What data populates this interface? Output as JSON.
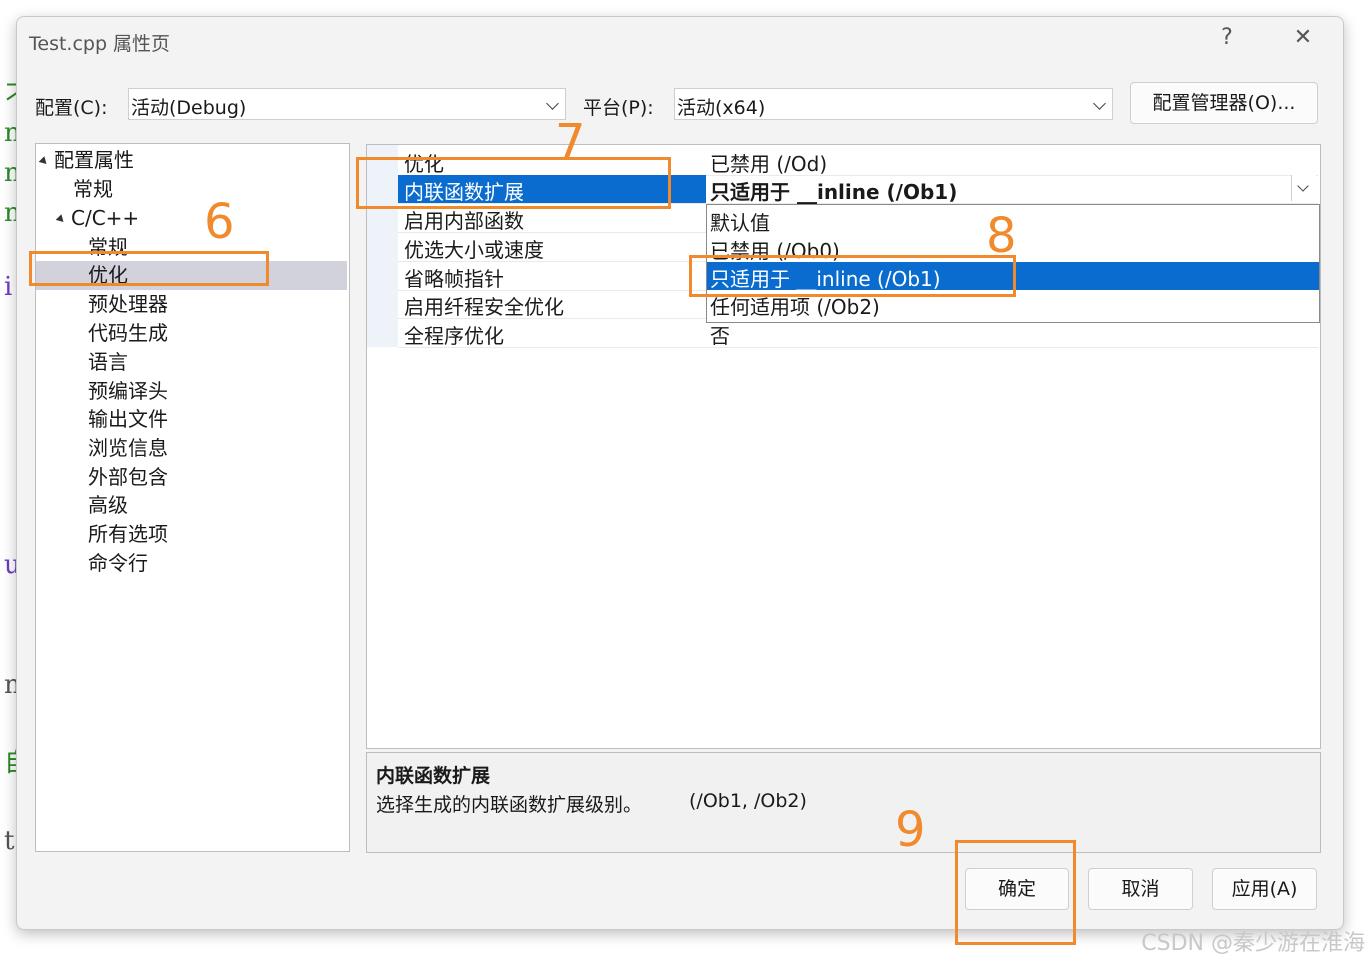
{
  "background_fragments": [
    "刁",
    "n",
    "n",
    "n",
    "i",
    "u",
    "n",
    "自",
    "t"
  ],
  "dialog": {
    "title": "Test.cpp 属性页",
    "help": "?",
    "close": "✕"
  },
  "toolbar": {
    "config_label": "配置(C):",
    "config_value": "活动(Debug)",
    "platform_label": "平台(P):",
    "platform_value": "活动(x64)",
    "config_manager": "配置管理器(O)..."
  },
  "tree": {
    "root": "配置属性",
    "general": "常规",
    "cpp": "C/C++",
    "children": [
      "常规",
      "优化",
      "预处理器",
      "代码生成",
      "语言",
      "预编译头",
      "输出文件",
      "浏览信息",
      "外部包含",
      "高级",
      "所有选项",
      "命令行"
    ],
    "selected": "优化"
  },
  "properties": [
    {
      "name": "优化",
      "value": "已禁用 (/Od)"
    },
    {
      "name": "内联函数扩展",
      "value": "只适用于 __inline (/Ob1)"
    },
    {
      "name": "启用内部函数",
      "value": ""
    },
    {
      "name": "优选大小或速度",
      "value": ""
    },
    {
      "name": "省略帧指针",
      "value": ""
    },
    {
      "name": "启用纤程安全优化",
      "value": ""
    },
    {
      "name": "全程序优化",
      "value": "否"
    }
  ],
  "dropdown_options": [
    "默认值",
    "已禁用 (/Ob0)",
    "只适用于 __inline (/Ob1)",
    "任何适用项 (/Ob2)"
  ],
  "dropdown_selected": "只适用于 __inline (/Ob1)",
  "description": {
    "title": "内联函数扩展",
    "text": "选择生成的内联函数扩展级别。",
    "flags": "(/Ob1, /Ob2)"
  },
  "buttons": {
    "ok": "确定",
    "cancel": "取消",
    "apply": "应用(A)"
  },
  "annotations": [
    "6",
    "7",
    "8",
    "9"
  ],
  "annotation_color": "#f08a2c",
  "selection_color": "#0a6ccf",
  "watermark": "CSDN @秦少游在淮海"
}
